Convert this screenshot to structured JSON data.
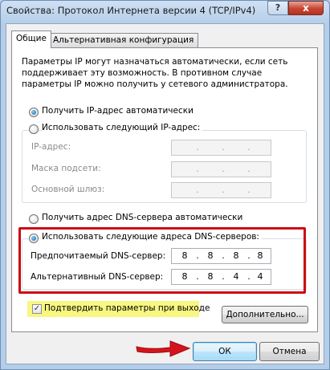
{
  "window": {
    "title": "Свойства: Протокол Интернета версии 4 (TCP/IPv4)",
    "help_icon": "?",
    "close_icon": "x"
  },
  "tabs": [
    {
      "label": "Общие",
      "active": true
    },
    {
      "label": "Альтернативная конфигурация",
      "active": false
    }
  ],
  "description": "Параметры IP могут назначаться автоматически, если сеть поддерживает эту возможность. В противном случае параметры IP можно получить у сетевого администратора.",
  "ip_section": {
    "auto_label": "Получить IP-адрес автоматически",
    "auto_selected": true,
    "manual_label": "Использовать следующий IP-адрес:",
    "manual_selected": false,
    "fields": [
      {
        "label": "IP-адрес:",
        "value": [
          "",
          "",
          "",
          ""
        ]
      },
      {
        "label": "Маска подсети:",
        "value": [
          "",
          "",
          "",
          ""
        ]
      },
      {
        "label": "Основной шлюз:",
        "value": [
          "",
          "",
          "",
          ""
        ]
      }
    ]
  },
  "dns_section": {
    "auto_label": "Получить адрес DNS-сервера автоматически",
    "auto_selected": false,
    "manual_label": "Использовать следующие адреса DNS-серверов:",
    "manual_selected": true,
    "preferred_label": "Предпочитаемый DNS-сервер:",
    "preferred_value": [
      "8",
      "8",
      "8",
      "8"
    ],
    "alternate_label": "Альтернативный DNS-сервер:",
    "alternate_value": [
      "8",
      "8",
      "4",
      "4"
    ]
  },
  "validate": {
    "label": "Подтвердить параметры при выходе",
    "checked": true,
    "check_glyph": "✓"
  },
  "buttons": {
    "advanced": "Дополнительно...",
    "ok": "ОК",
    "cancel": "Отмена"
  },
  "colors": {
    "highlight_red": "#cc0a14",
    "highlight_yellow": "#f7f781",
    "arrow_red": "#d4141c"
  }
}
